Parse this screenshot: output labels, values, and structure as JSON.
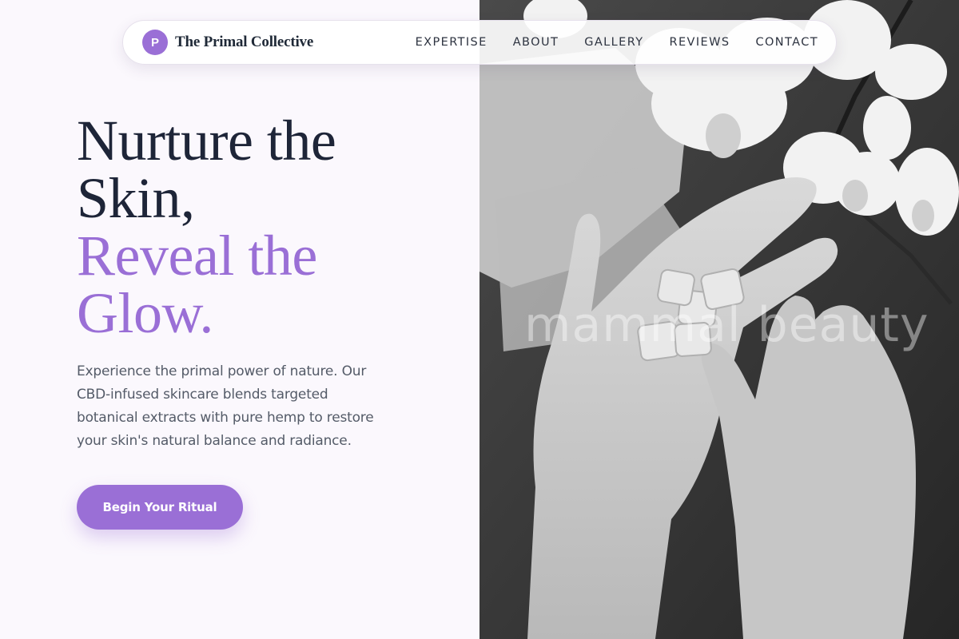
{
  "brand": {
    "mark": "P",
    "name": "The Primal Collective",
    "accent_color": "#9a6fd6"
  },
  "nav": {
    "links": [
      "EXPERTISE",
      "ABOUT",
      "GALLERY",
      "REVIEWS",
      "CONTACT"
    ]
  },
  "hero": {
    "headline_line1": "Nurture the",
    "headline_line2": "Skin,",
    "headline_accent_line1": "Reveal the",
    "headline_accent_line2": "Glow.",
    "description": "Experience the primal power of nature. Our CBD-infused skincare blends targeted botanical extracts with pure hemp to restore your skin's natural balance and radiance.",
    "cta_label": "Begin Your Ritual",
    "image_watermark": "mammal beauty"
  }
}
